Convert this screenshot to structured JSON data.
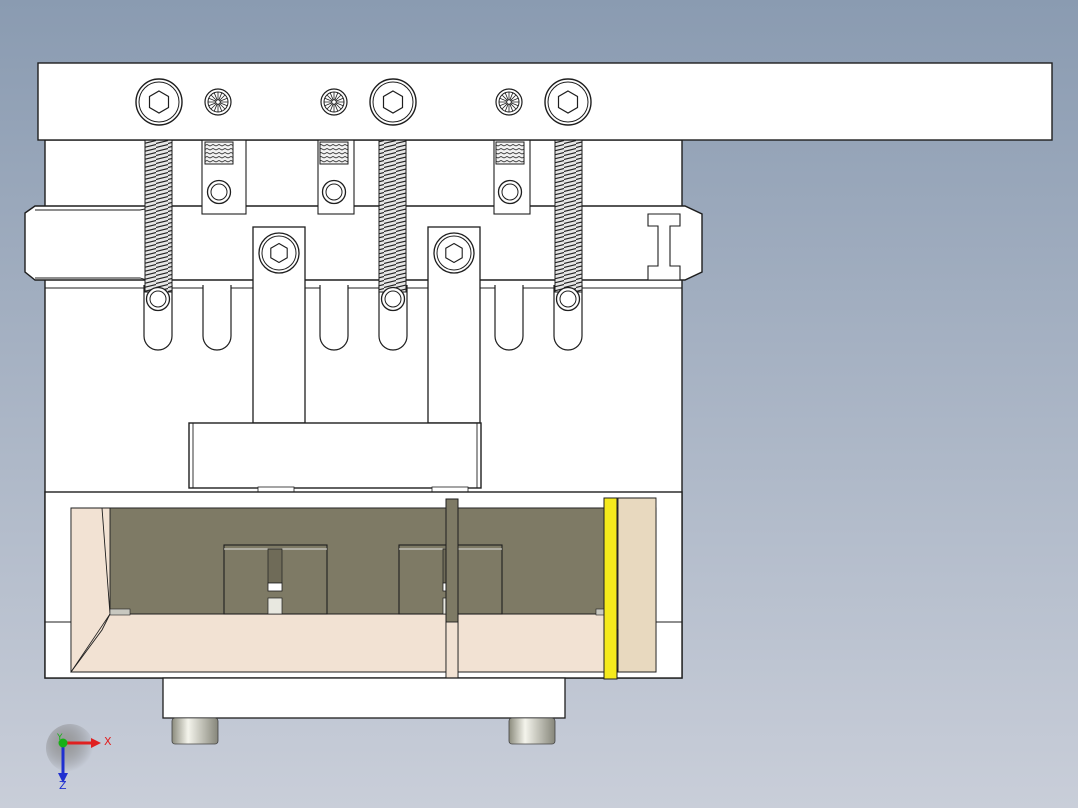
{
  "viewport": {
    "background_top": "#8a9bb1",
    "background_bottom": "#c9ced9"
  },
  "colors": {
    "part_fill": "#ffffff",
    "outline": "#1e1e1e",
    "cavity": "#7e7a65",
    "tray": "#f2e2d3",
    "side_block": "#e8d9bf",
    "yellow_bar": "#f5ea1c",
    "axis_x": "#e02020",
    "axis_y": "#18b018",
    "axis_z": "#2030d0"
  },
  "triad": {
    "x_label": "X",
    "y_label": "Y",
    "z_label": "Z"
  },
  "icons": {
    "cap_screw": "hex-socket-screw-icon",
    "knurled_screw": "knurled-screw-icon",
    "axis_triad": "axis-triad-icon"
  }
}
